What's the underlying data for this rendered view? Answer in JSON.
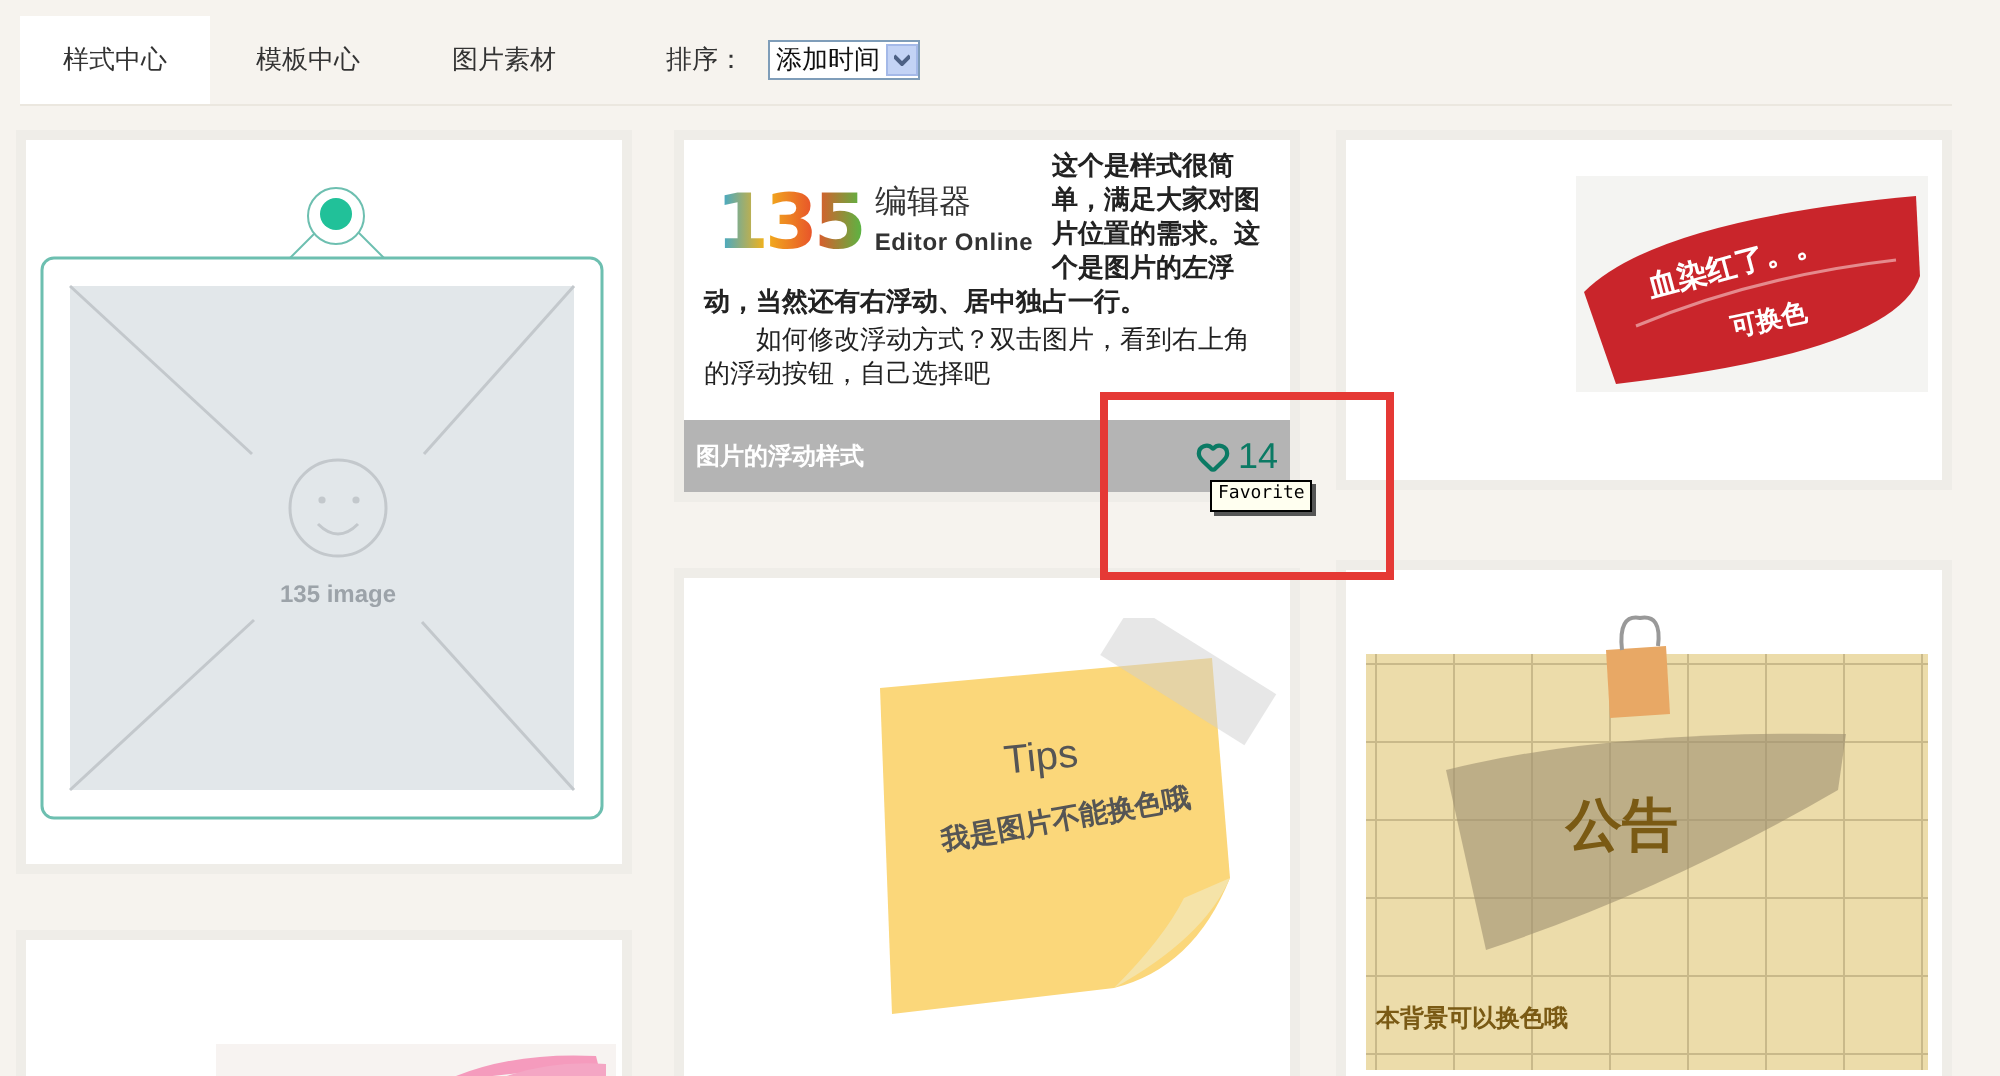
{
  "tabs": [
    {
      "label": "样式中心",
      "selected": true
    },
    {
      "label": "模板中心",
      "selected": false
    },
    {
      "label": "图片素材",
      "selected": false
    }
  ],
  "sort": {
    "label": "排序：",
    "value": "添加时间"
  },
  "columns": [
    [
      {
        "kind": "placeholder",
        "caption": "135 image"
      },
      {
        "kind": "pink-stroke"
      }
    ],
    [
      {
        "kind": "float-text",
        "logo": "135",
        "logo_title": "编辑器",
        "logo_subtitle": "Editor Online",
        "paragraphs": [
          "这个是样式很简单，满足大家对**图片位置**的需求。这个是**图片的左浮**",
          "**动**，当然还有**右浮动、居中独占一行**。",
          "如何修改浮动方式？双击图片，看到右上角的浮动按钮，自己选择吧"
        ],
        "overlay_title": "图片的浮动样式",
        "likes": "14",
        "tooltip": "Favorite"
      },
      {
        "kind": "sticky-note",
        "title": "Tips",
        "subtitle": "我是图片不能换色哦"
      }
    ],
    [
      {
        "kind": "red-brush",
        "title": "血染红了。。",
        "subtitle": "可换色"
      },
      {
        "kind": "notice",
        "title": "公告",
        "footer": "本背景可以换色哦"
      }
    ]
  ]
}
